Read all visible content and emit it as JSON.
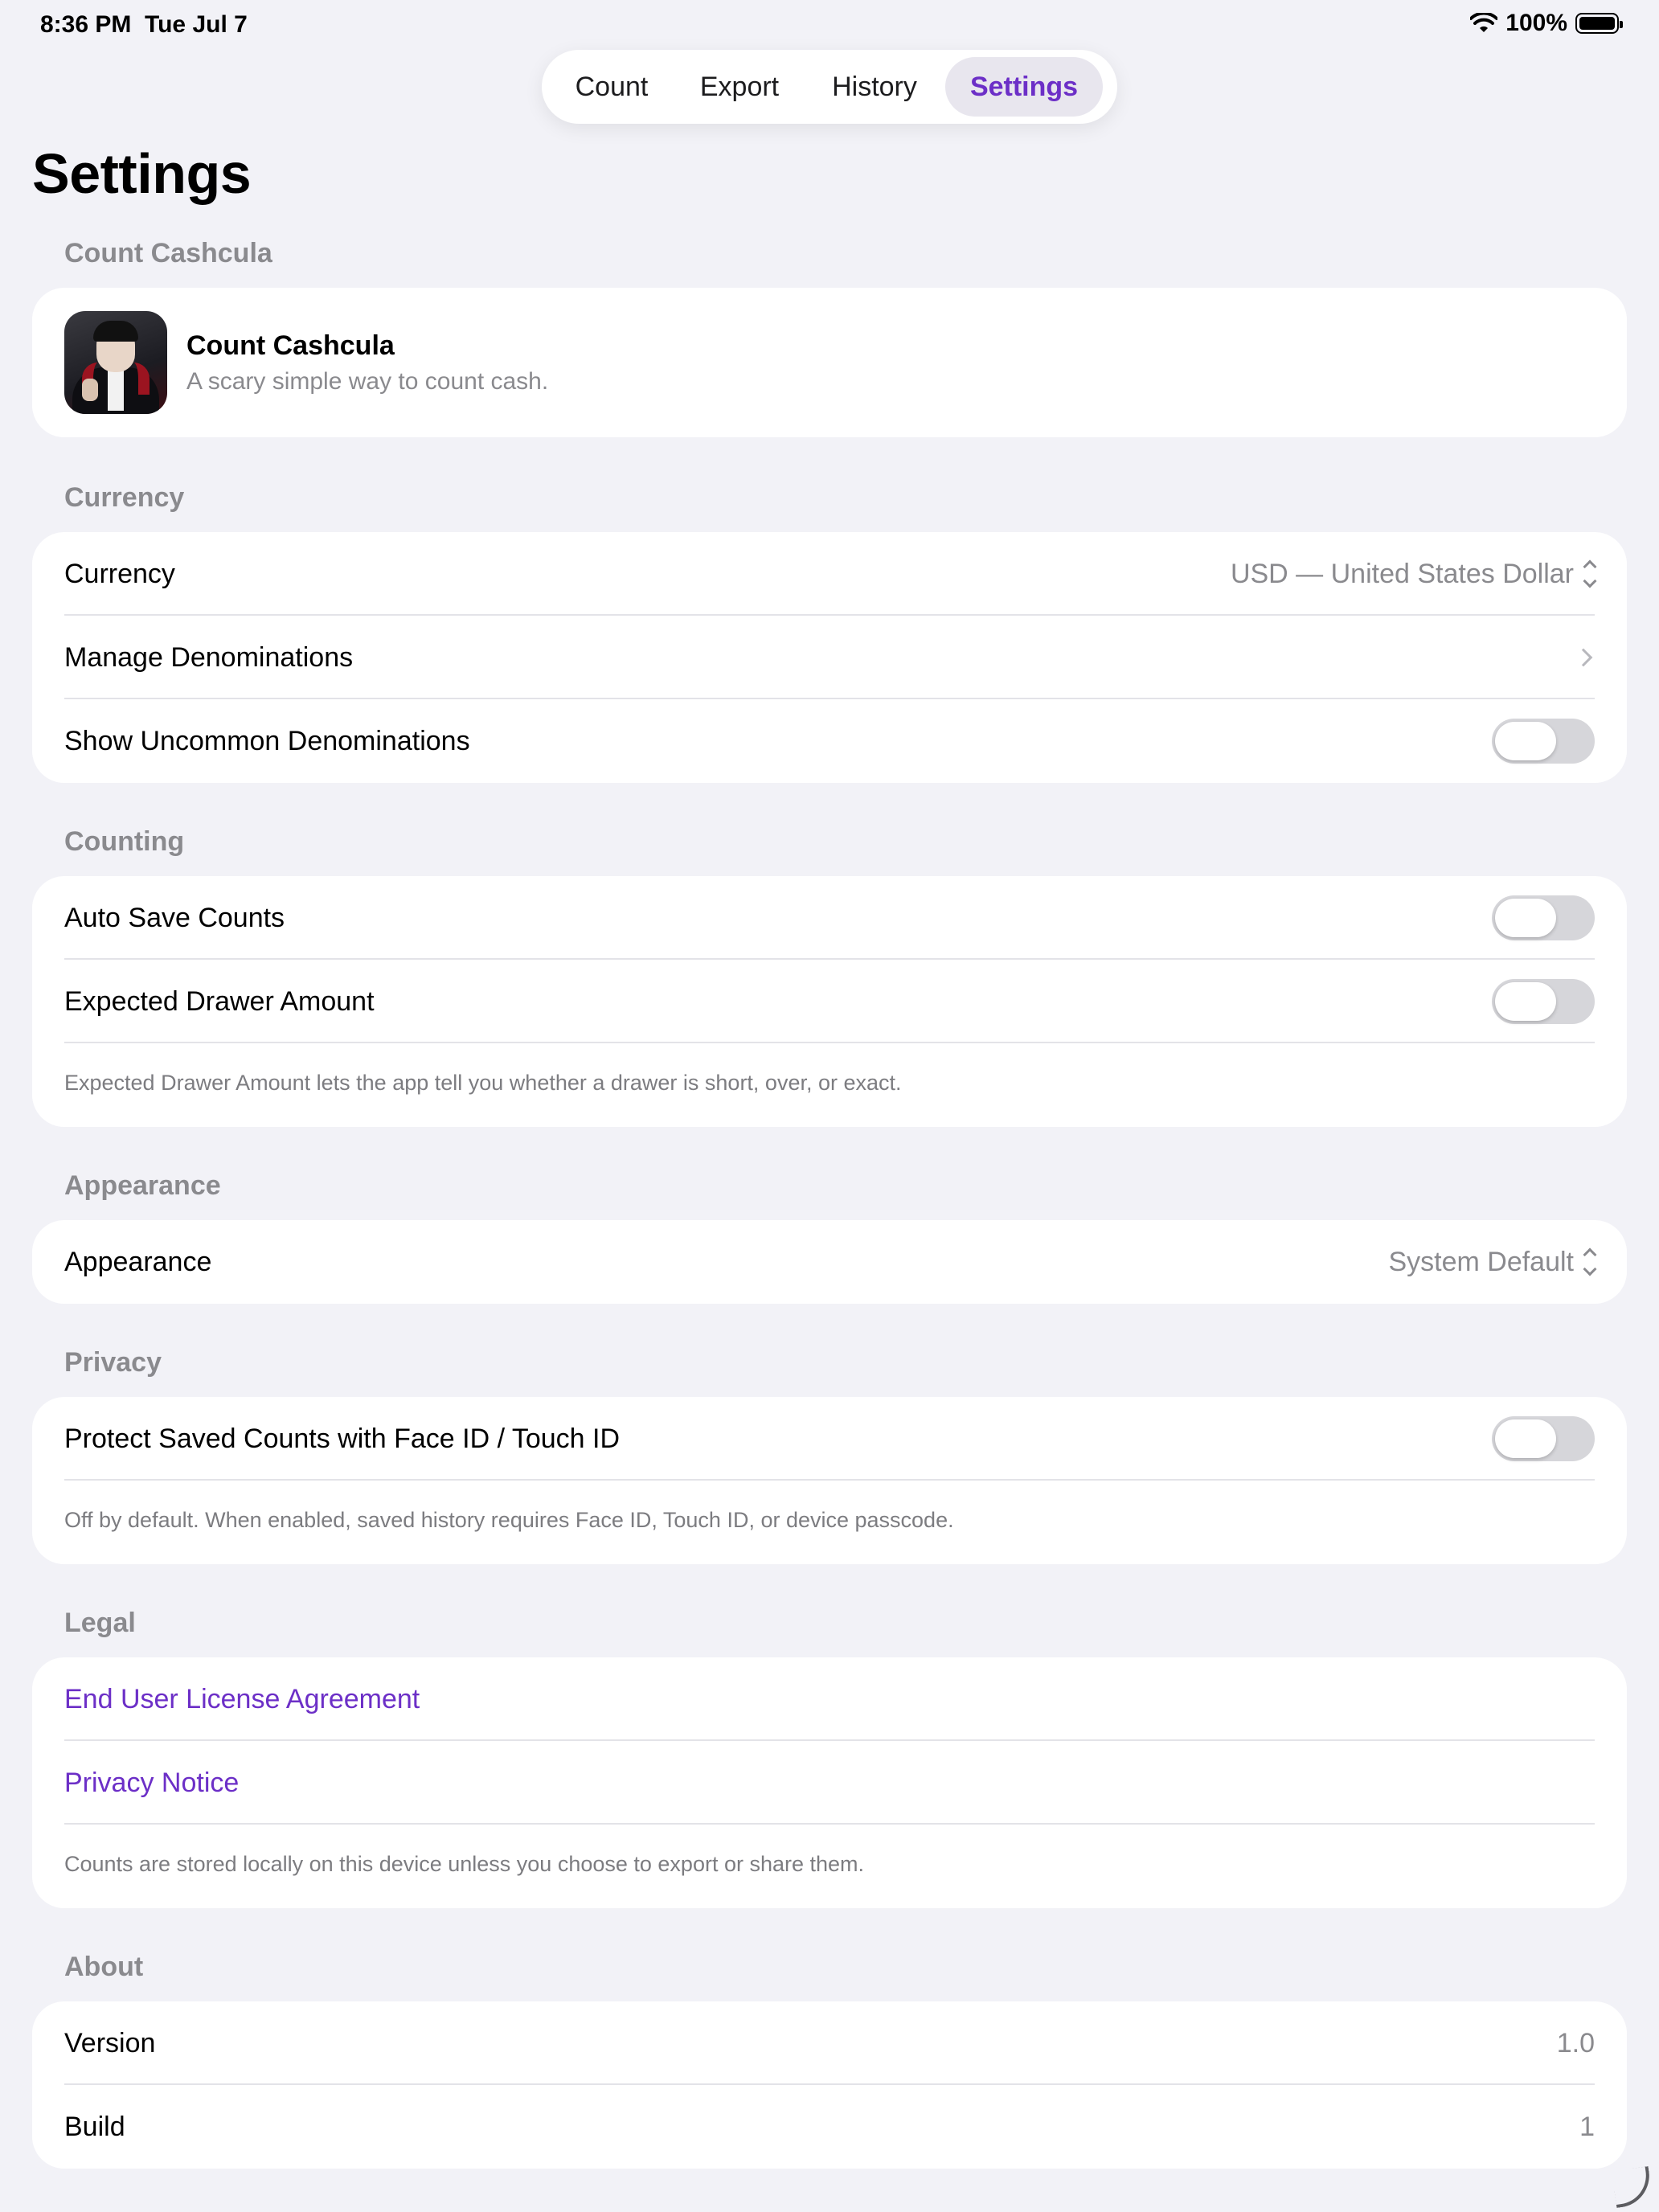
{
  "status_bar": {
    "time": "8:36 PM",
    "date": "Tue Jul 7",
    "battery": "100%"
  },
  "tabs": [
    {
      "label": "Count"
    },
    {
      "label": "Export"
    },
    {
      "label": "History"
    },
    {
      "label": "Settings",
      "selected": true
    }
  ],
  "page_title": "Settings",
  "accent_color": "#6c2fc7",
  "sections": {
    "app": {
      "header": "Count Cashcula",
      "name": "Count Cashcula",
      "tagline": "A scary simple way to count cash."
    },
    "currency": {
      "header": "Currency",
      "currency_label": "Currency",
      "currency_value": "USD — United States Dollar",
      "manage_label": "Manage Denominations",
      "uncommon_label": "Show Uncommon Denominations",
      "uncommon_on": false
    },
    "counting": {
      "header": "Counting",
      "auto_save_label": "Auto Save Counts",
      "auto_save_on": false,
      "expected_label": "Expected Drawer Amount",
      "expected_on": false,
      "footnote": "Expected Drawer Amount lets the app tell you whether a drawer is short, over, or exact."
    },
    "appearance": {
      "header": "Appearance",
      "label": "Appearance",
      "value": "System Default"
    },
    "privacy": {
      "header": "Privacy",
      "protect_label": "Protect Saved Counts with Face ID / Touch ID",
      "protect_on": false,
      "footnote": "Off by default. When enabled, saved history requires Face ID, Touch ID, or device passcode."
    },
    "legal": {
      "header": "Legal",
      "eula": "End User License Agreement",
      "privacy_notice": "Privacy Notice",
      "footnote": "Counts are stored locally on this device unless you choose to export or share them."
    },
    "about": {
      "header": "About",
      "version_label": "Version",
      "version_value": "1.0",
      "build_label": "Build",
      "build_value": "1"
    }
  }
}
